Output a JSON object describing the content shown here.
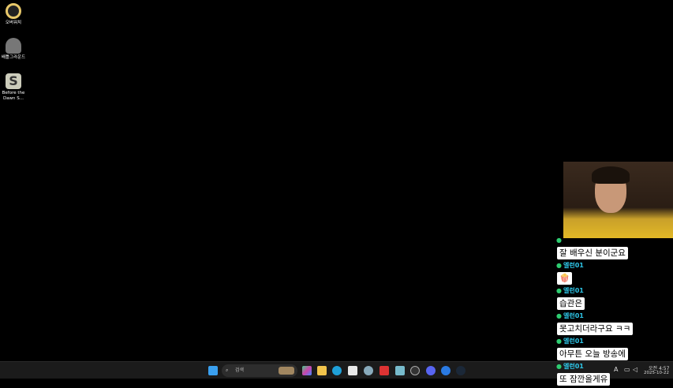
{
  "desktop": {
    "icons": [
      {
        "label": "오버워치"
      },
      {
        "label": "배틀그라운드"
      },
      {
        "label": "Before the Dawn S..."
      }
    ]
  },
  "chat": {
    "messages": [
      {
        "user": "",
        "text": "잘 배우신 분이군요"
      },
      {
        "user": "엘런01",
        "text": "🍿"
      },
      {
        "user": "엘런01",
        "text": "습관은"
      },
      {
        "user": "엘런01",
        "text": "못고치더라구요 ㅋㅋ"
      },
      {
        "user": "엘런01",
        "text": "아무튼 오늘 방송에"
      },
      {
        "user": "엘런01",
        "text": "또 잠깐올게유"
      }
    ]
  },
  "taskbar": {
    "search_placeholder": "검색",
    "ime": "A",
    "time": "오전 4:57",
    "date": "2025-10-22"
  }
}
